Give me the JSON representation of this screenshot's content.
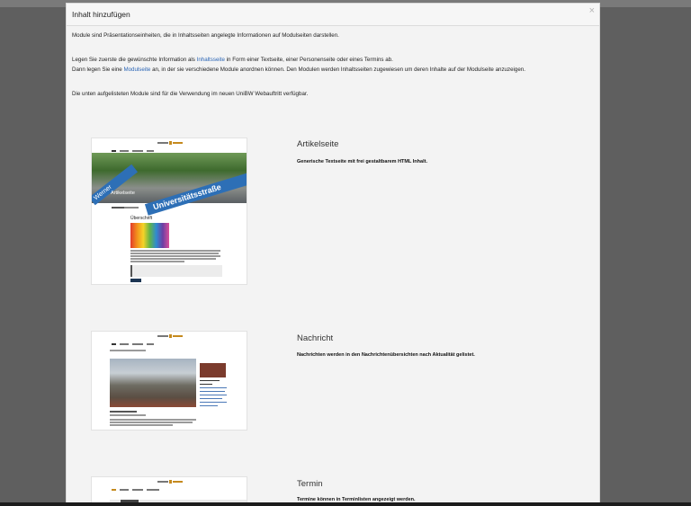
{
  "dialog": {
    "title": "Inhalt hinzufügen",
    "close_icon": "×",
    "intro": {
      "line1": "Module sind Präsentationseinheiten, die in Inhaltsseiten angelegte Informationen auf Modulseiten darstellen.",
      "line2_pre": "Legen Sie zuerste die gewünschte Information als ",
      "line2_link": "Inhaltsseite",
      "line2_post": " in Form einer Textseite, einer Personenseite oder eines Termins ab.",
      "line3_pre": "Dann legen Sie eine ",
      "line3_link": "Modulseite",
      "line3_post": " an, in der sie verschiedene Module anordnen können. Den Modulen werden Inhaltsseiten zugewiesen um deren Inhalte auf der Modulseite anzuzeigen.",
      "line4": "Die unten aufgelisteten Module sind für die Verwendung im neuen UniBW Webauftritt verfügbar."
    },
    "modules": [
      {
        "title": "Artikelseite",
        "description": "Generische Textseite mit frei gestaltbarem HTML Inhalt.",
        "preview": {
          "hero_label": "Artikelseite",
          "sign_text": "Universitätsstraße",
          "sign2_text": "Werner",
          "heading": "Überschrift"
        }
      },
      {
        "title": "Nachricht",
        "description": "Nachrichten werden in den Nachrichtenübersichten nach Aktualität gelistet."
      },
      {
        "title": "Termin",
        "description": "Termine können in Terminlisten angezeigt werden."
      }
    ]
  },
  "colors": {
    "link": "#2b65b5",
    "dialog_bg": "#f3f3f3",
    "overlay": "#5f5f5f",
    "sign_blue": "#2d6fb6"
  }
}
